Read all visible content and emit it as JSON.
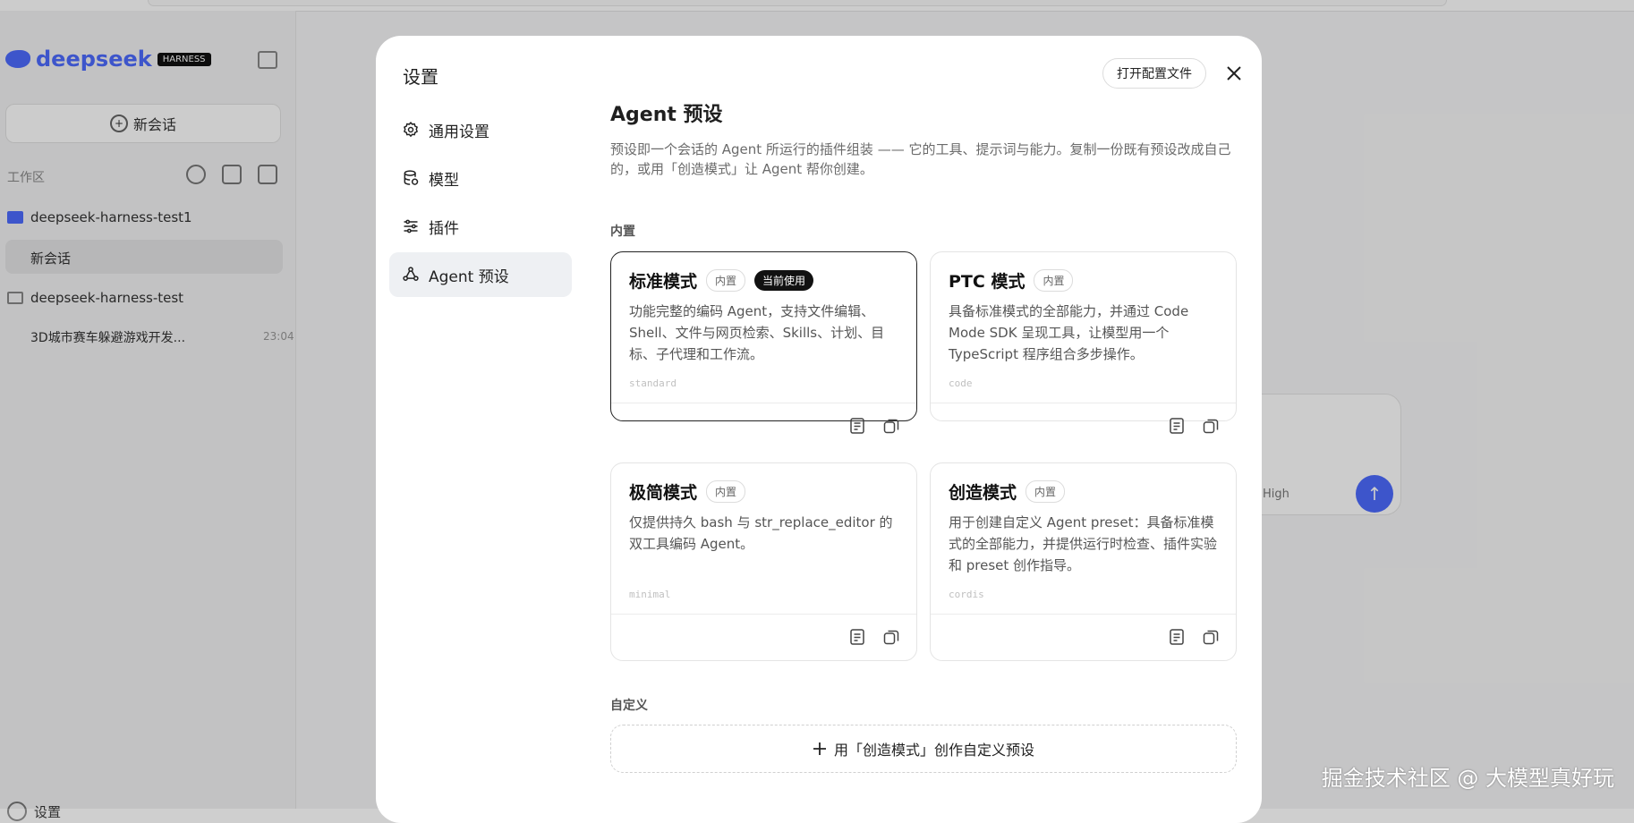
{
  "background": {
    "brand": "deepseek",
    "brand_tag": "HARNESS",
    "new_chat": "新会话",
    "workspace_label": "工作区",
    "projects": [
      {
        "name": "deepseek-harness-test1"
      },
      {
        "name": "deepseek-harness-test"
      }
    ],
    "active_chat": "新会话",
    "chat2_title": "3D城市赛车躲避游戏开发...",
    "chat2_time": "23:04",
    "settings_label": "设置",
    "chat_mode": "High",
    "accent": "#4d6bfe"
  },
  "modal": {
    "title": "设置",
    "open_config": "打开配置文件",
    "nav": [
      {
        "label": "通用设置",
        "icon": "gear-icon"
      },
      {
        "label": "模型",
        "icon": "database-icon"
      },
      {
        "label": "插件",
        "icon": "sliders-icon"
      },
      {
        "label": "Agent 预设",
        "icon": "agent-icon",
        "active": true
      }
    ],
    "content": {
      "heading": "Agent 预设",
      "description": "预设即一个会话的 Agent 所运行的插件组装 —— 它的工具、提示词与能力。复制一份既有预设改成自己的，或用「创造模式」让 Agent 帮你创建。",
      "builtin_label": "内置",
      "custom_label": "自定义",
      "add_custom": "用「创造模式」创作自定义预设",
      "presets": [
        {
          "title": "标准模式",
          "badge": "内置",
          "current_badge": "当前使用",
          "description": "功能完整的编码 Agent，支持文件编辑、Shell、文件与网页检索、Skills、计划、目标、子代理和工作流。",
          "id": "standard"
        },
        {
          "title": "PTC 模式",
          "badge": "内置",
          "description": "具备标准模式的全部能力，并通过 Code Mode SDK 呈现工具，让模型用一个 TypeScript 程序组合多步操作。",
          "id": "code"
        },
        {
          "title": "极简模式",
          "badge": "内置",
          "description": "仅提供持久 bash 与 str_replace_editor 的双工具编码 Agent。",
          "id": "minimal"
        },
        {
          "title": "创造模式",
          "badge": "内置",
          "description": "用于创建自定义 Agent preset：具备标准模式的全部能力，并提供运行时检查、插件实验和 preset 创作指导。",
          "id": "cordis"
        }
      ]
    }
  },
  "watermark": "掘金技术社区 @ 大模型真好玩"
}
